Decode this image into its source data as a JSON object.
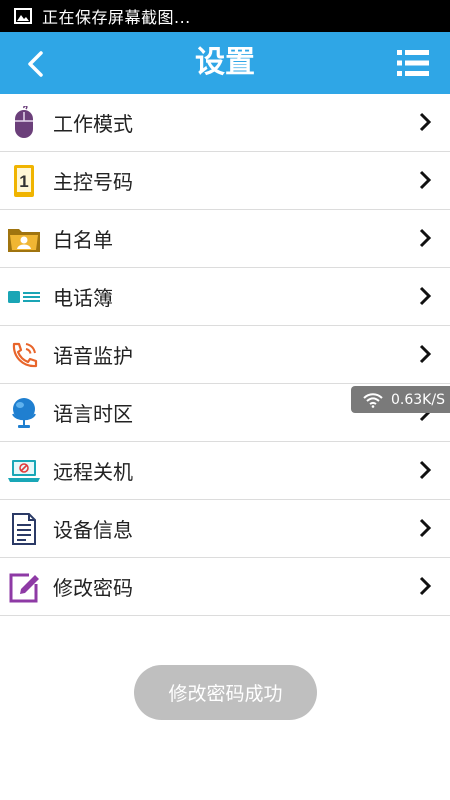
{
  "status_bar": {
    "text": "正在保存屏幕截图...",
    "icon": "image-icon"
  },
  "app_bar": {
    "title": "设置",
    "back_icon": "back-arrow-icon",
    "menu_icon": "list-menu-icon",
    "color": "#2fa6e6"
  },
  "settings": {
    "items": [
      {
        "label": "工作模式",
        "icon": "mouse-icon"
      },
      {
        "label": "主控号码",
        "icon": "phone-number-icon"
      },
      {
        "label": "白名单",
        "icon": "contact-folder-icon"
      },
      {
        "label": "电话簿",
        "icon": "phonebook-icon"
      },
      {
        "label": "语音监护",
        "icon": "call-monitor-icon"
      },
      {
        "label": "语言时区",
        "icon": "globe-icon"
      },
      {
        "label": "远程关机",
        "icon": "laptop-power-icon"
      },
      {
        "label": "设备信息",
        "icon": "document-icon"
      },
      {
        "label": "修改密码",
        "icon": "edit-icon"
      }
    ]
  },
  "net_speed": {
    "value": "0.63K/S",
    "icon": "wifi-icon"
  },
  "toast": {
    "message": "修改密码成功"
  }
}
